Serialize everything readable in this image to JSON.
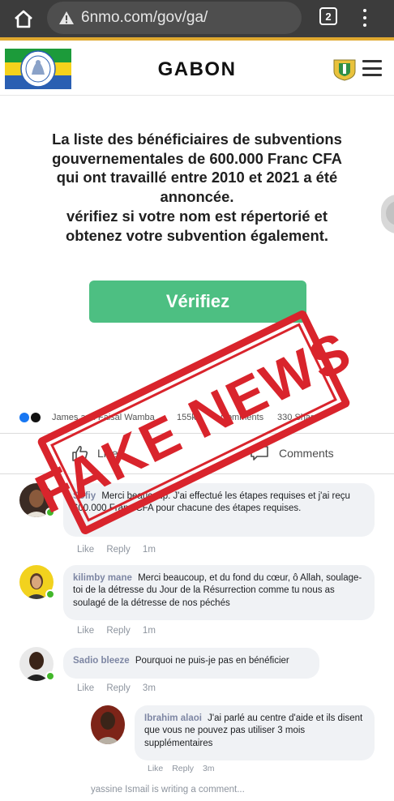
{
  "browser": {
    "url": "6nmo.com/gov/ga/",
    "tab_count": "2",
    "icons": {
      "home": "home-icon",
      "warning": "warning-icon",
      "tabs": "tabs-icon",
      "menu": "more-vert-icon"
    }
  },
  "site": {
    "title": "GABON",
    "flag_colors": [
      "#1c9b3a",
      "#f5d21c",
      "#2a5fb2"
    ]
  },
  "announcement": {
    "lines": [
      "La liste des bénéficiaires de subventions",
      "gouvernementales de 600.000 Franc CFA",
      "qui ont travaillé entre 2010 et 2021 a été",
      "annoncée.",
      "vérifiez si votre nom est répertorié et",
      "obtenez votre subvention également."
    ],
    "button_label": "Vérifiez",
    "button_color": "#4dbf82"
  },
  "post_stats": {
    "names": "James and Faisal Wamba",
    "likes": "155k",
    "comments": "Comments",
    "shares": "330 Share"
  },
  "actions": {
    "like_label": "Like",
    "comment_label": "Comments"
  },
  "comments": [
    {
      "name": "Sofiy",
      "text": "Merci beaucoup. J'ai effectué les étapes requises et j'ai reçu 600.000 Franc CFA pour chacune des étapes requises.",
      "like": "Like",
      "reply": "Reply",
      "time": "1m"
    },
    {
      "name": "kilimby mane",
      "text": "Merci beaucoup, et du fond du cœur, ô Allah, soulage-toi de la détresse du Jour de la Résurrection comme tu nous as soulagé de la détresse de nos péchés",
      "like": "Like",
      "reply": "Reply",
      "time": "1m"
    },
    {
      "name": "Sadio bleeze",
      "text": "Pourquoi ne puis-je pas en bénéficier",
      "like": "Like",
      "reply": "Reply",
      "time": "3m"
    },
    {
      "name": "Ibrahim alaoi",
      "text": "J'ai parlé au centre d'aide et ils disent que vous ne pouvez pas utiliser 3 mois supplémentaires",
      "like": "Like",
      "reply": "Reply",
      "time": "3m"
    }
  ],
  "typing_indicator": "yassine Ismail is writing a comment...",
  "stamp": {
    "text": "FAKE NEWS",
    "color": "#d9242c"
  }
}
